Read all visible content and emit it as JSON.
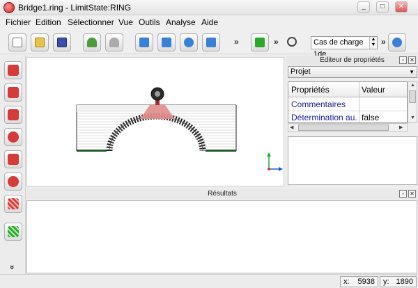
{
  "window": {
    "title": "Bridge1.ring - LimitState:RING",
    "minimize": "_",
    "maximize": "□",
    "close": "✕"
  },
  "menu": [
    "Fichier",
    "Edition",
    "Sélectionner",
    "Vue",
    "Outils",
    "Analyse",
    "Aide"
  ],
  "toolbar": {
    "more": "»",
    "load_case": "Cas de charge 1de",
    "spin_up": "▲",
    "spin_down": "▼"
  },
  "left_tools": {
    "more": "»"
  },
  "properties_panel": {
    "title": "Editeur de propriétés",
    "dock_float": "▫",
    "dock_close": "✕",
    "object_select": "Projet",
    "columns": [
      "Propriétés",
      "Valeur"
    ],
    "rows": [
      {
        "property": "Commentaires",
        "value": ""
      },
      {
        "property": "Détermination au...",
        "value": "false"
      }
    ]
  },
  "results_panel": {
    "title": "Résultats",
    "dock_float": "▫",
    "dock_close": "✕"
  },
  "status": {
    "x_label": "x:",
    "x_value": "5938",
    "y_label": "y:",
    "y_value": "1890"
  },
  "colors": {
    "accent_red": "#d43c3c",
    "run_green": "#2aa82a",
    "tool_blue": "#3b7fd6",
    "property_text": "#1b1b9b"
  }
}
